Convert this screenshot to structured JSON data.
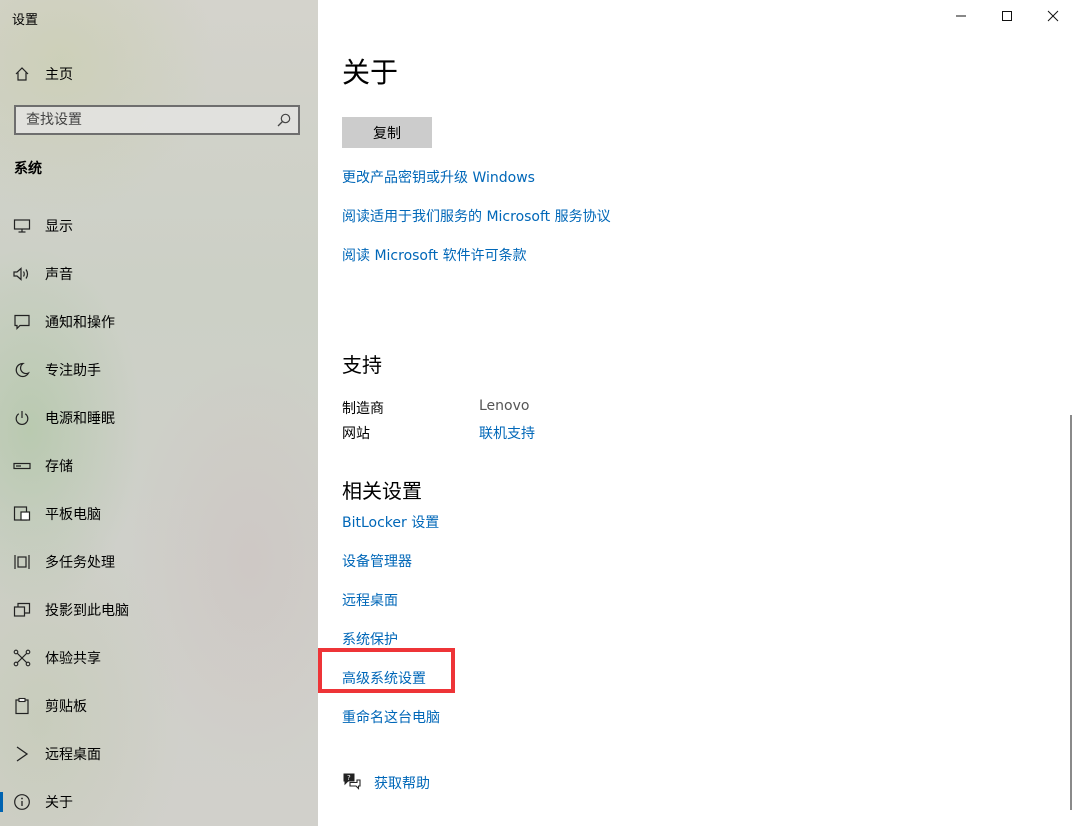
{
  "window": {
    "app_title": "设置"
  },
  "sidebar": {
    "home_label": "主页",
    "search_placeholder": "查找设置",
    "section_label": "系统",
    "items": [
      {
        "label": "显示",
        "icon": "monitor-icon"
      },
      {
        "label": "声音",
        "icon": "speaker-icon"
      },
      {
        "label": "通知和操作",
        "icon": "notification-icon"
      },
      {
        "label": "专注助手",
        "icon": "moon-icon"
      },
      {
        "label": "电源和睡眠",
        "icon": "power-icon"
      },
      {
        "label": "存储",
        "icon": "storage-icon"
      },
      {
        "label": "平板电脑",
        "icon": "tablet-icon"
      },
      {
        "label": "多任务处理",
        "icon": "multitasking-icon"
      },
      {
        "label": "投影到此电脑",
        "icon": "project-icon"
      },
      {
        "label": "体验共享",
        "icon": "share-icon"
      },
      {
        "label": "剪贴板",
        "icon": "clipboard-icon"
      },
      {
        "label": "远程桌面",
        "icon": "remote-icon"
      },
      {
        "label": "关于",
        "icon": "info-icon",
        "selected": true
      }
    ]
  },
  "main": {
    "title": "关于",
    "copy_button": "复制",
    "links": [
      "更改产品密钥或升级 Windows",
      "阅读适用于我们服务的 Microsoft 服务协议",
      "阅读 Microsoft 软件许可条款"
    ],
    "support": {
      "heading": "支持",
      "manufacturer_label": "制造商",
      "manufacturer_value": "Lenovo",
      "website_label": "网站",
      "website_value": "联机支持"
    },
    "related": {
      "heading": "相关设置",
      "links": [
        "BitLocker 设置",
        "设备管理器",
        "远程桌面",
        "系统保护",
        "高级系统设置",
        "重命名这台电脑"
      ]
    },
    "help_label": "获取帮助"
  },
  "colors": {
    "accent": "#0067b8",
    "highlight_box": "#ee3437",
    "button_bg": "#cccccc"
  }
}
